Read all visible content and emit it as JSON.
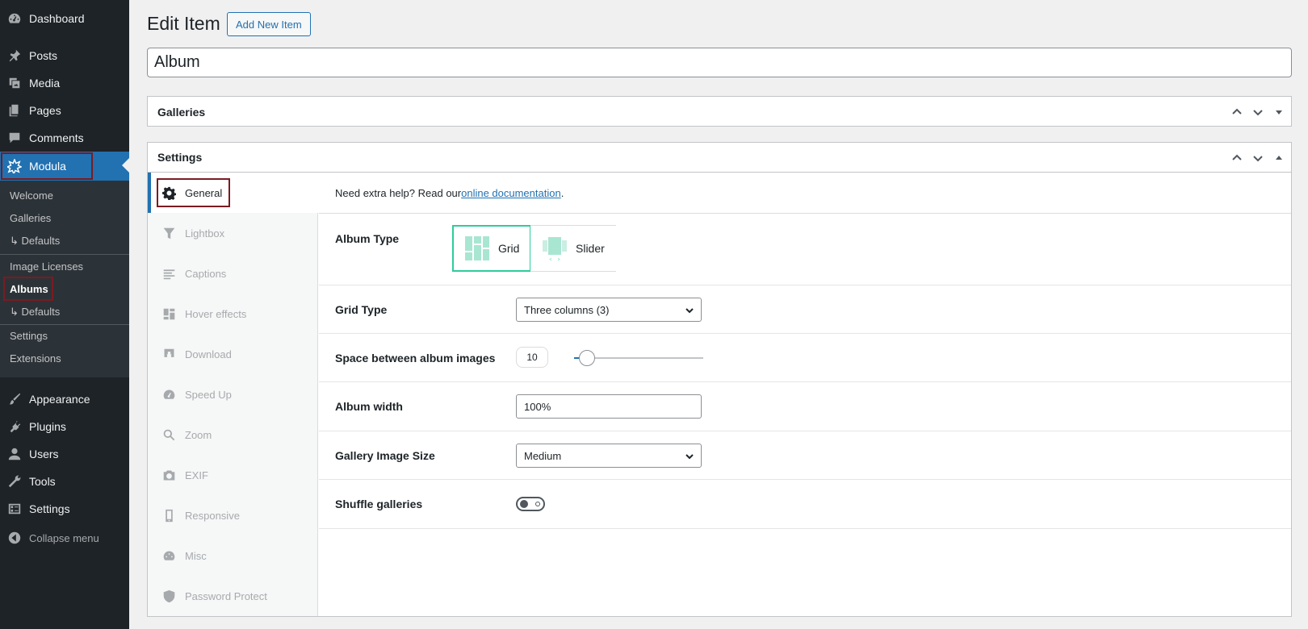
{
  "sidebar": {
    "top_items": [
      {
        "label": "Dashboard",
        "icon": "dashboard-icon"
      },
      {
        "label": "Posts",
        "icon": "pin-icon"
      },
      {
        "label": "Media",
        "icon": "media-icon"
      },
      {
        "label": "Pages",
        "icon": "pages-icon"
      },
      {
        "label": "Comments",
        "icon": "comment-icon"
      },
      {
        "label": "Modula",
        "icon": "modula-icon"
      }
    ],
    "submenu": [
      "Welcome",
      "Galleries",
      "↳ Defaults",
      "Image Licenses",
      "Albums",
      "↳ Defaults",
      "Settings",
      "Extensions"
    ],
    "bottom_items": [
      {
        "label": "Appearance",
        "icon": "brush-icon"
      },
      {
        "label": "Plugins",
        "icon": "plug-icon"
      },
      {
        "label": "Users",
        "icon": "user-icon"
      },
      {
        "label": "Tools",
        "icon": "wrench-icon"
      },
      {
        "label": "Settings",
        "icon": "settings-icon"
      },
      {
        "label": "Collapse menu",
        "icon": "collapse-icon"
      }
    ],
    "accent": "#2271b1"
  },
  "header": {
    "title": "Edit Item",
    "add_new_label": "Add New Item",
    "item_title_value": "Album"
  },
  "galleries_box": {
    "title": "Galleries"
  },
  "settings_box": {
    "title": "Settings",
    "tabs": [
      "General",
      "Lightbox",
      "Captions",
      "Hover effects",
      "Download",
      "Speed Up",
      "Zoom",
      "EXIF",
      "Responsive",
      "Misc",
      "Password Protect"
    ],
    "help_prefix": "Need extra help? Read our ",
    "help_link": "online documentation",
    "help_suffix": ".",
    "fields": {
      "album_type": {
        "label": "Album Type",
        "options": [
          "Grid",
          "Slider"
        ],
        "selected": "Grid"
      },
      "grid_type": {
        "label": "Grid Type",
        "value": "Three columns (3)"
      },
      "space_between": {
        "label": "Space between album images",
        "value": "10",
        "slider_fraction": 0.1
      },
      "album_width": {
        "label": "Album width",
        "value": "100%"
      },
      "gallery_image_size": {
        "label": "Gallery Image Size",
        "value": "Medium"
      },
      "shuffle": {
        "label": "Shuffle galleries",
        "enabled": false
      }
    },
    "accent_selected": "#2ecc9b"
  },
  "highlight_color": "#7a1b22"
}
